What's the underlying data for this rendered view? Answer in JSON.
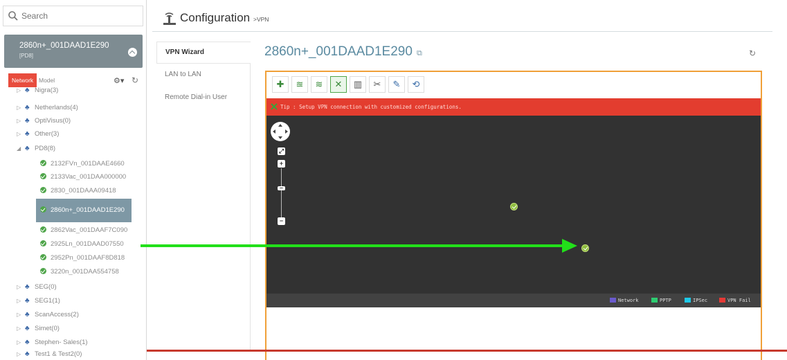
{
  "search": {
    "placeholder": "Search"
  },
  "device_card": {
    "name": "2860n+_001DAAD1E290",
    "group": "[PD8]"
  },
  "tree_tabs": {
    "network": "Network",
    "model": "Model"
  },
  "tree": {
    "top_partial": "Nigra(3)",
    "groups_before": [
      "Netherlands(4)",
      "OptiVisus(0)",
      "Other(3)"
    ],
    "open_group": "PD8(8)",
    "devices": [
      "2132FVn_001DAAE4660",
      "2133Vac_001DAA000000",
      "2830_001DAAA09418",
      "2860n+_001DAAD1E290",
      "2862Vac_001DAAF7C090",
      "2925Ln_001DAAD07550",
      "2952Pn_001DAAF8D818",
      "3220n_001DAA554758"
    ],
    "groups_after": [
      "SEG(0)",
      "SEG1(1)",
      "ScanAccess(2)",
      "Simet(0)",
      "Stephen- Sales(1)",
      "Test1 & Test2(0)"
    ]
  },
  "header": {
    "title": "Configuration",
    "breadcrumb": ">VPN"
  },
  "submenu": [
    "VPN Wizard",
    "LAN to LAN",
    "Remote Dial-in User"
  ],
  "main": {
    "device_title": "2860n+_001DAAD1E290"
  },
  "tip": "Tip : Setup VPN connection with customized configurations.",
  "legend": [
    {
      "label": "Network",
      "color": "#6a5acd"
    },
    {
      "label": "PPTP",
      "color": "#2ecc71"
    },
    {
      "label": "IPSec",
      "color": "#1ec8e8"
    },
    {
      "label": "VPN Fail",
      "color": "#e53935"
    }
  ],
  "colors": {
    "accent": "#f0a038",
    "tip_bg": "#e33d2f",
    "arrow": "#22e01a"
  }
}
